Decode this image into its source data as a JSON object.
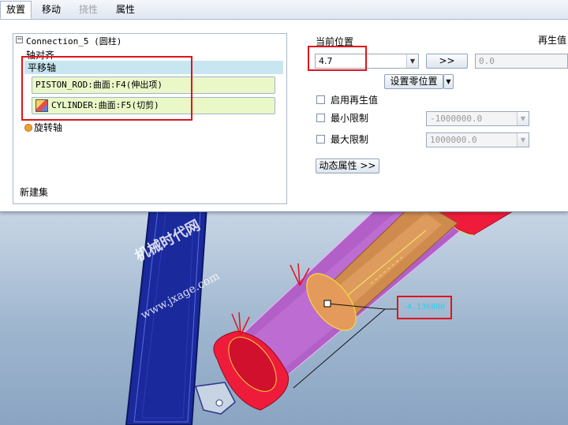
{
  "tabs": [
    {
      "label": "放置",
      "state": "active"
    },
    {
      "label": "移动",
      "state": "normal"
    },
    {
      "label": "挠性",
      "state": "disabled"
    },
    {
      "label": "属性",
      "state": "normal"
    }
  ],
  "tree": {
    "connection": "Connection_5 (圆柱)",
    "axis_align": "轴对齐",
    "translation_axis": "平移轴",
    "ref1": "PISTON_ROD:曲面:F4(伸出项)",
    "ref2": "CYLINDER:曲面:F5(切剪)",
    "rotation_axis": "旋转轴",
    "new_set": "新建集"
  },
  "right_panel": {
    "current_position_label": "当前位置",
    "regen_value_label": "再生值",
    "current_position_value": "4.7",
    "arrow_button": ">>",
    "regen_value": "0.0",
    "set_zero_button": "设置零位置",
    "enable_regen_label": "启用再生值",
    "min_limit_label": "最小限制",
    "min_limit_value": "-1000000.0",
    "max_limit_label": "最大限制",
    "max_limit_value": "1000000.0",
    "dynamic_props_button": "动态属性 >>"
  },
  "viewport": {
    "dimension_value": "-4.136000",
    "watermark_line1": "机械时代网",
    "watermark_line2": "www.jxage.com"
  },
  "colors": {
    "selection_red": "#e0141a",
    "reference_green": "#eaf8c8",
    "selected_row": "#c7e6f0",
    "cylinder_purple": "#b25fc8",
    "cylinder_end_red": "#ee1c3a",
    "rod_orange": "#cf8a4e",
    "frame_blue": "#1a2a9c",
    "dimension_cyan": "#18d6f0"
  }
}
